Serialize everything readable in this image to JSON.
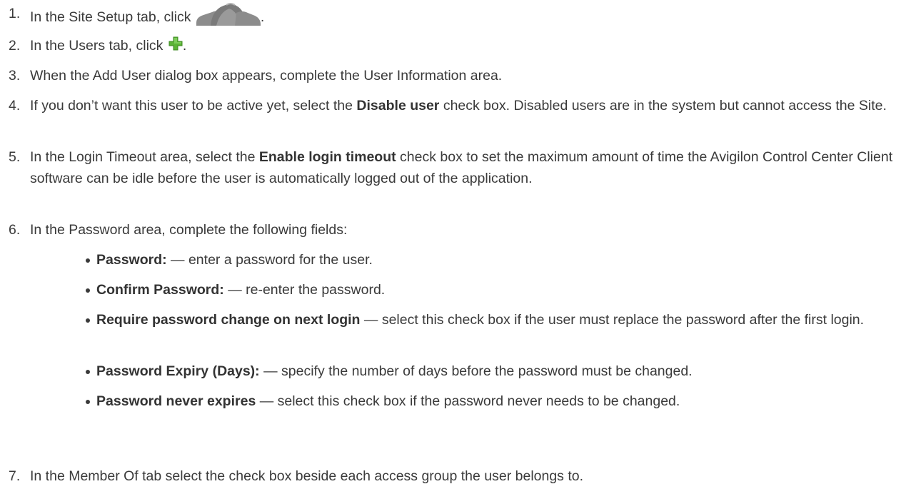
{
  "steps": [
    {
      "num": "1.",
      "before": "In the Site Setup tab, click ",
      "icon": "users-group-icon",
      "after": "."
    },
    {
      "num": "2.",
      "before": "In the Users tab, click ",
      "icon": "green-plus-icon",
      "after": "."
    },
    {
      "num": "3.",
      "text": "When the Add User dialog box appears, complete the User Information area."
    },
    {
      "num": "4.",
      "before": "If you don’t want this user to be active yet, select the ",
      "bold": "Disable user",
      "after": " check box. Disabled users are in the system but cannot access the Site."
    },
    {
      "num": "5.",
      "before": "In the Login Timeout area, select the ",
      "bold": "Enable login timeout",
      "after": " check box to set the maximum amount of time the Avigilon Control Center Client software can be idle before the user is automatically logged out of the application."
    },
    {
      "num": "6.",
      "text": "In the Password area, complete the following fields:"
    },
    {
      "num": "7.",
      "text": "In the Member Of tab select the check box beside each access group the user belongs to."
    }
  ],
  "password_fields": [
    {
      "bold": "Password:",
      "text": " — enter a password for the user."
    },
    {
      "bold": "Confirm Password:",
      "text": " — re-enter the password."
    },
    {
      "bold": "Require password change on next login",
      "text": " — select this check box if the user must replace the password after the first login."
    },
    {
      "bold": "Password Expiry (Days):",
      "text": " — specify the number of days before the password must be changed."
    },
    {
      "bold": "Password never expires",
      "text": " — select this check box if the password never needs to be changed."
    }
  ],
  "colors": {
    "text": "#3a3a3a",
    "icon_gray": "#8a8a8a",
    "plus_green": "#5bb336"
  }
}
